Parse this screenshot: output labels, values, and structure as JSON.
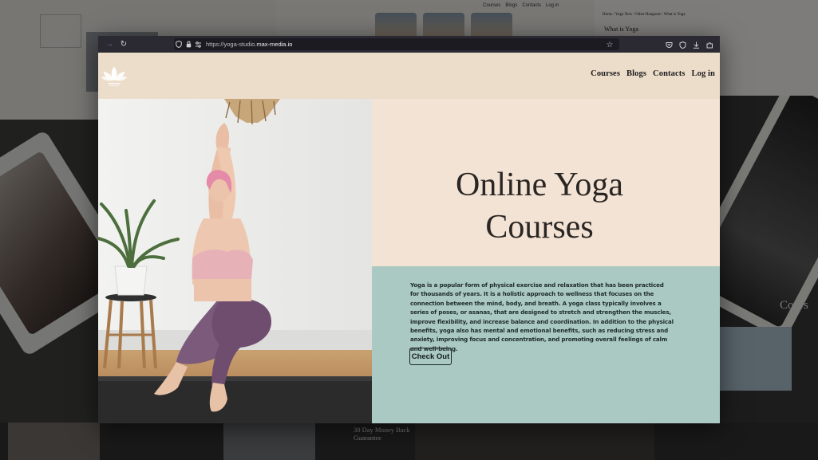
{
  "browser": {
    "url_prefix": "https://yoga-studio.",
    "url_domain": "max-media.io"
  },
  "site": {
    "logo_icon": "lotus-icon",
    "nav": [
      {
        "label": "Courses"
      },
      {
        "label": "Blogs"
      },
      {
        "label": "Contacts"
      },
      {
        "label": "Log in"
      }
    ],
    "hero": {
      "title_line1": "Online Yoga",
      "title_line2": "Courses",
      "description": "Yoga is a popular form of physical exercise and relaxation that has been practiced for thousands of years. It is a holistic approach to wellness that focuses on the connection between the mind, body, and breath. A yoga class typically involves a series of poses, or asanas, that are designed to stretch and strengthen the muscles, improve flexibility, and increase balance and coordination. In addition to the physical benefits, yoga also has mental and emotional benefits, such as reducing stress and anxiety, improving focus and concentration, and promoting overall feelings of calm and well-being.",
      "cta_label": "Check Out"
    }
  },
  "background": {
    "menu_items": [
      "Courses",
      "Blogs",
      "Contacts",
      "Log in"
    ],
    "breadcrumb": "Home / Yoga Now / Other Hangouts / What is Yoga",
    "what_is_yoga": "What is Yoga",
    "course_heading": "Cours",
    "guarantee_line1": "30 Day Money Back",
    "guarantee_line2": "Guarantee"
  },
  "colors": {
    "header_bg": "#ecdcca",
    "title_panel_bg": "#f3e3d5",
    "desc_panel_bg": "#a9c9c2",
    "text_dark": "#2a2623"
  }
}
